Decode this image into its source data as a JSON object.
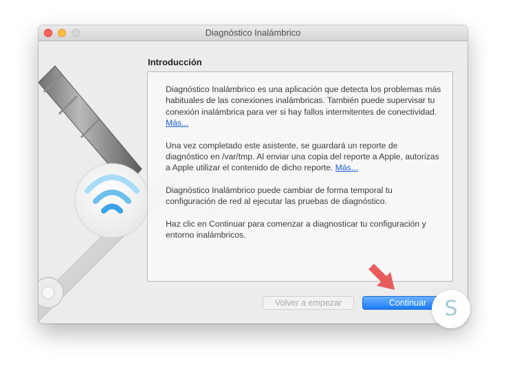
{
  "window": {
    "title": "Diagnóstico Inalámbrico"
  },
  "section": {
    "heading": "Introducción"
  },
  "content": {
    "p1": "Diagnóstico Inalámbrico es una aplicación que detecta los problemas más habituales de las conexiones inalámbricas. También puede supervisar tu conexión inalámbrica para ver si hay fallos intermitentes de conectividad.",
    "p1_link": "Más...",
    "p2": "Una vez completado este asistente, se guardará un reporte de diagnóstico en /var/tmp. Al enviar una copia del reporte a Apple, autorizas a Apple utilizar el contenido de dicho reporte.",
    "p2_link": "Más...",
    "p3": "Diagnóstico Inalámbrico puede cambiar de forma temporal tu configuración de red al ejecutar las pruebas de diagnóstico.",
    "p4": "Haz clic en Continuar para comenzar a diagnosticar tu configuración y entorno inalámbricos."
  },
  "buttons": {
    "back_label": "Volver a empezar",
    "continue_label": "Continuar"
  },
  "badge": {
    "letter": "S"
  },
  "colors": {
    "accent": "#1a7cf5",
    "link": "#1f5fd6",
    "arrow": "#e85c5c",
    "wifi": "#4aaee8"
  },
  "icons": {
    "wrench": "wrench-icon",
    "wifi": "wifi-icon",
    "arrow": "arrow-down-right-icon"
  }
}
